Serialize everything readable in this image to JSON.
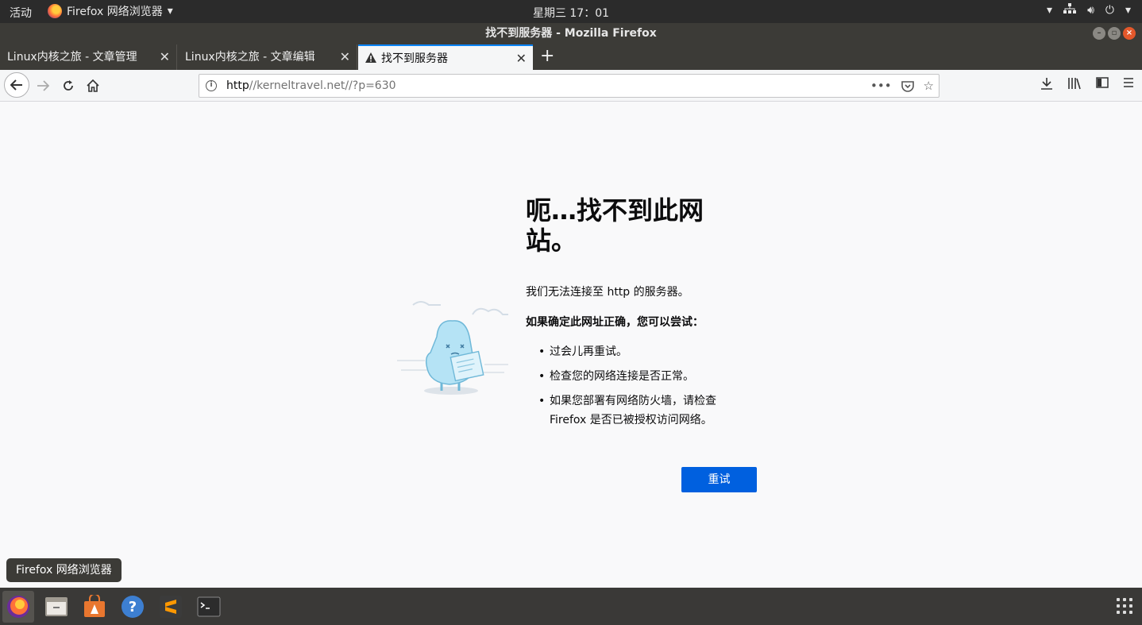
{
  "topbar": {
    "activities": "活动",
    "app_name": "Firefox 网络浏览器",
    "clock": "星期三 17：01"
  },
  "window": {
    "title": "找不到服务器 - Mozilla Firefox"
  },
  "tabs": [
    {
      "label": "Linux内核之旅 - 文章管理"
    },
    {
      "label": "Linux内核之旅 - 文章编辑"
    },
    {
      "label": "找不到服务器",
      "active": true
    }
  ],
  "url": {
    "scheme": "http",
    "rest": "//kerneltravel.net//?p=630"
  },
  "error": {
    "title": "呃…找不到此网站。",
    "desc": "我们无法连接至 http 的服务器。",
    "sub": "如果确定此网址正确，您可以尝试：",
    "tips": [
      "过会儿再重试。",
      "检查您的网络连接是否正常。",
      "如果您部署有网络防火墙，请检查 Firefox 是否已被授权访问网络。"
    ],
    "retry": "重试"
  },
  "tooltip": "Firefox 网络浏览器",
  "colors": {
    "accent": "#0060df",
    "tab_highlight": "#0a84ff",
    "title_bar": "#3c3b37"
  }
}
